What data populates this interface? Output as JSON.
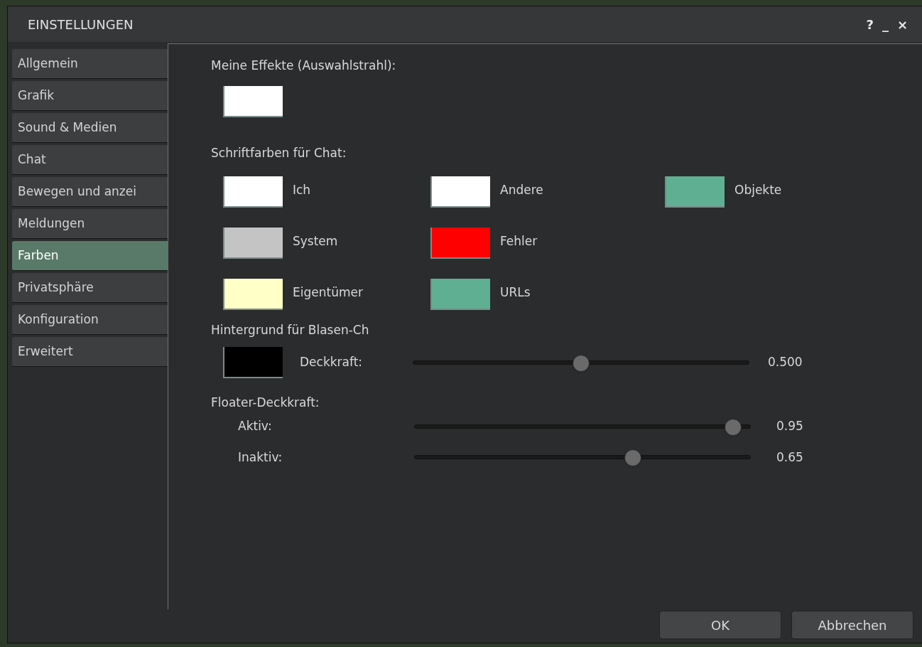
{
  "window": {
    "title": "EINSTELLUNGEN",
    "controls": [
      "?",
      "_",
      "×"
    ]
  },
  "sidebar": {
    "items": [
      {
        "label": "Allgemein",
        "selected": false
      },
      {
        "label": "Grafik",
        "selected": false
      },
      {
        "label": "Sound & Medien",
        "selected": false
      },
      {
        "label": "Chat",
        "selected": false
      },
      {
        "label": "Bewegen und anzei",
        "selected": false
      },
      {
        "label": "Meldungen",
        "selected": false
      },
      {
        "label": "Farben",
        "selected": true
      },
      {
        "label": "Privatsphäre",
        "selected": false
      },
      {
        "label": "Konfiguration",
        "selected": false
      },
      {
        "label": "Erweitert",
        "selected": false
      }
    ]
  },
  "effects": {
    "label": "Meine Effekte (Auswahlstrahl):",
    "color": "#ffffff"
  },
  "chat_colors": {
    "label": "Schriftfarben für Chat:",
    "rows": [
      [
        {
          "label": "Ich",
          "color": "#ffffff"
        },
        {
          "label": "Andere",
          "color": "#ffffff"
        },
        {
          "label": "Objekte",
          "color": "#5fb092"
        }
      ],
      [
        {
          "label": "System",
          "color": "#c4c4c4"
        },
        {
          "label": "Fehler",
          "color": "#ff0000"
        }
      ],
      [
        {
          "label": "Eigentümer",
          "color": "#ffffc8"
        },
        {
          "label": "URLs",
          "color": "#5fb092"
        }
      ]
    ]
  },
  "bubble": {
    "label": "Hintergrund für Blasen-Ch",
    "color": "#000000",
    "opacity_label": "Deckkraft:",
    "level": 0.5,
    "reading": "0.500"
  },
  "floater": {
    "label": "Floater-Deckkraft:",
    "sliders": [
      {
        "label": "Aktiv:",
        "level": 0.95,
        "reading": "0.95"
      },
      {
        "label": "Inaktiv:",
        "level": 0.65,
        "reading": "0.65"
      }
    ]
  },
  "buttons": [
    "OK",
    "Abbrechen"
  ]
}
